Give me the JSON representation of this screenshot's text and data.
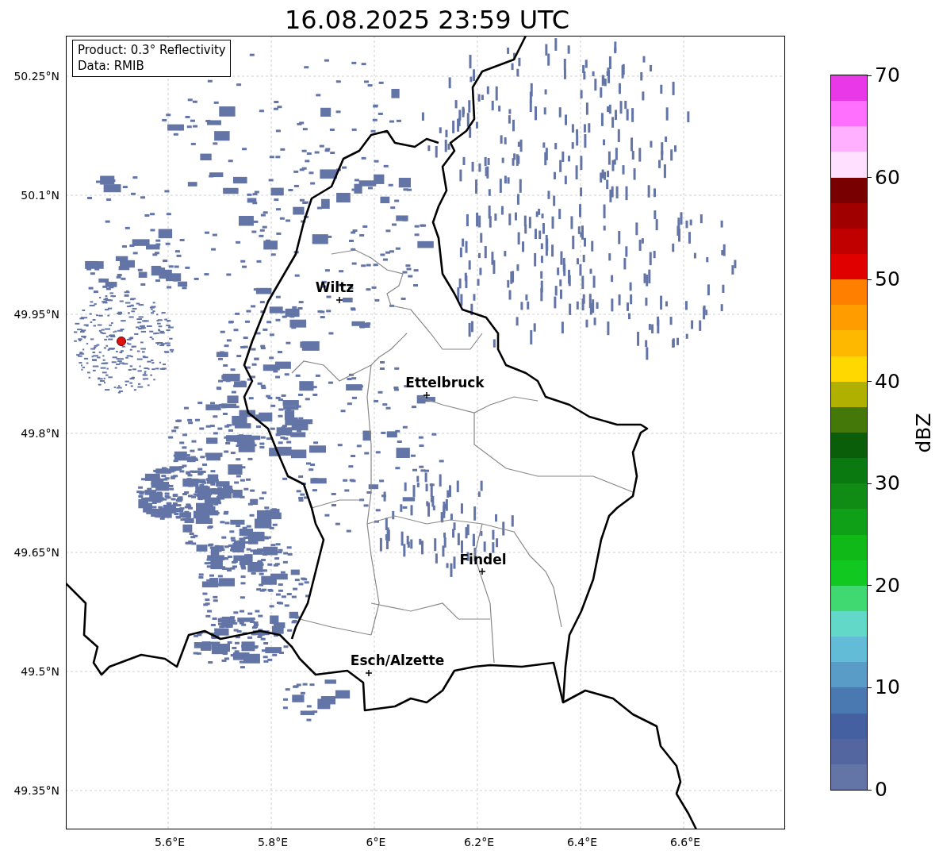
{
  "title": "16.08.2025 23:59 UTC",
  "info_box": {
    "lines": [
      "Product: 0.3° Reflectivity",
      "Data: RMIB"
    ]
  },
  "map": {
    "latitude_labels": [
      "50.25°N",
      "50.1°N",
      "49.95°N",
      "49.8°N",
      "49.65°N",
      "49.5°N",
      "49.35°N"
    ],
    "longitude_labels": [
      "5.6°E",
      "5.8°E",
      "6°E",
      "6.2°E",
      "6.4°E",
      "6.6°E"
    ],
    "cities": [
      "Wiltz",
      "Ettelbruck",
      "Findel",
      "Esch/Alzette"
    ]
  },
  "colorbar": {
    "label": "dBZ",
    "ticks": [
      "70",
      "60",
      "50",
      "40",
      "30",
      "20",
      "10",
      "0"
    ],
    "segments": [
      {
        "color": "#e838e8"
      },
      {
        "color": "#ff70ff"
      },
      {
        "color": "#ffb0ff"
      },
      {
        "color": "#ffe0ff"
      },
      {
        "color": "#780000"
      },
      {
        "color": "#a00000"
      },
      {
        "color": "#c00000"
      },
      {
        "color": "#e00000"
      },
      {
        "color": "#ff8000"
      },
      {
        "color": "#ff9c00"
      },
      {
        "color": "#ffb800"
      },
      {
        "color": "#ffd800"
      },
      {
        "color": "#b0b000"
      },
      {
        "color": "#447808"
      },
      {
        "color": "#0a5e0a"
      },
      {
        "color": "#0a7a10"
      },
      {
        "color": "#108c14"
      },
      {
        "color": "#10a018"
      },
      {
        "color": "#10b818"
      },
      {
        "color": "#10c820"
      },
      {
        "color": "#40d870"
      },
      {
        "color": "#62d8c8"
      },
      {
        "color": "#62bcd8"
      },
      {
        "color": "#5a9cc8"
      },
      {
        "color": "#4a78b0"
      },
      {
        "color": "#4460a0"
      },
      {
        "color": "#5366a0"
      },
      {
        "color": "#6374a6"
      }
    ]
  }
}
